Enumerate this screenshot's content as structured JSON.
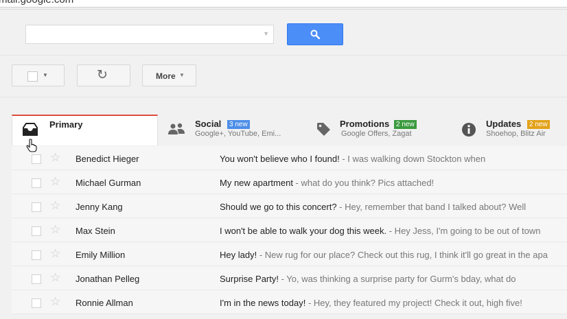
{
  "browser": {
    "url_fragment": "mail.google.com"
  },
  "search": {
    "value": "",
    "placeholder": ""
  },
  "toolbar": {
    "more_label": "More"
  },
  "icons": {
    "search": "search-icon",
    "dropdown": "chevron-down-icon",
    "refresh": "refresh-icon",
    "inbox": "inbox-icon",
    "social": "people-icon",
    "promotions": "tag-icon",
    "updates": "info-icon",
    "star": "star-icon"
  },
  "colors": {
    "search_button": "#4c8ef7",
    "social_badge": "#4d8ee8",
    "promotions_badge": "#3b9b3f",
    "updates_badge": "#e3a21a",
    "active_tab_accent": "#dd4b39"
  },
  "tabs": [
    {
      "label": "Primary"
    },
    {
      "label": "Social",
      "badge": "3 new",
      "subtitle": "Google+, YouTube, Emi..."
    },
    {
      "label": "Promotions",
      "badge": "2 new",
      "subtitle": "Google Offers, Zagat"
    },
    {
      "label": "Updates",
      "badge": "2 new",
      "subtitle": "Shoehop, Blitz Air"
    }
  ],
  "emails": [
    {
      "sender": "Benedict Hieger",
      "subject": "You won't believe who I found!",
      "snippet": " - I was walking down Stockton when"
    },
    {
      "sender": "Michael Gurman",
      "subject": "My new apartment",
      "snippet": " - what do you think? Pics attached!"
    },
    {
      "sender": "Jenny Kang",
      "subject": "Should we go to this concert?",
      "snippet": "  - Hey, remember that band I talked about? Well"
    },
    {
      "sender": "Max Stein",
      "subject": "I won't be able to walk your dog this week.",
      "snippet": " - Hey Jess, I'm going to be out of town"
    },
    {
      "sender": "Emily Million",
      "subject": "Hey lady!",
      "snippet": " - New rug for our place? Check out this rug, I think it'll go great in the apa"
    },
    {
      "sender": "Jonathan Pelleg",
      "subject": "Surprise Party!",
      "snippet": " - Yo, was thinking a surprise party for Gurm's bday, what do"
    },
    {
      "sender": "Ronnie Allman",
      "subject": "I'm in the news today!",
      "snippet": " - Hey, they featured my project! Check it out, high five!"
    }
  ]
}
